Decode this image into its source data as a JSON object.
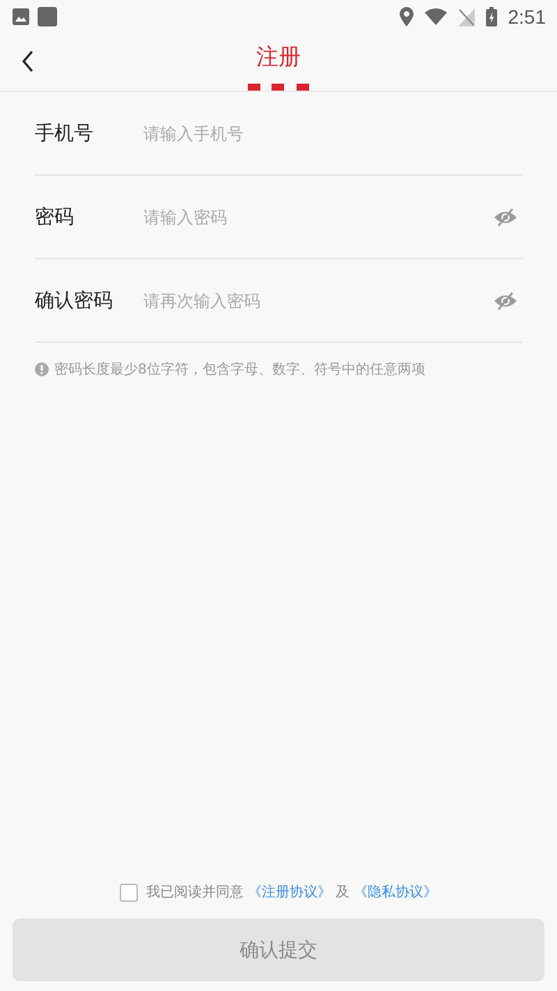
{
  "status_bar": {
    "time": "2:51"
  },
  "header": {
    "title": "注册"
  },
  "fields": [
    {
      "label": "手机号",
      "placeholder": "请输入手机号",
      "kind": "text"
    },
    {
      "label": "密码",
      "placeholder": "请输入密码",
      "kind": "password"
    },
    {
      "label": "确认密码",
      "placeholder": "请再次输入密码",
      "kind": "password"
    }
  ],
  "hint": "密码长度最少8位字符，包含字母、数字、符号中的任意两项",
  "agreement": {
    "checked": false,
    "text": "我已阅读并同意",
    "link_1": "《注册协议》",
    "joiner": "及",
    "link_2": "《隐私协议》"
  },
  "submit": {
    "label": "确认提交",
    "disabled": true
  }
}
